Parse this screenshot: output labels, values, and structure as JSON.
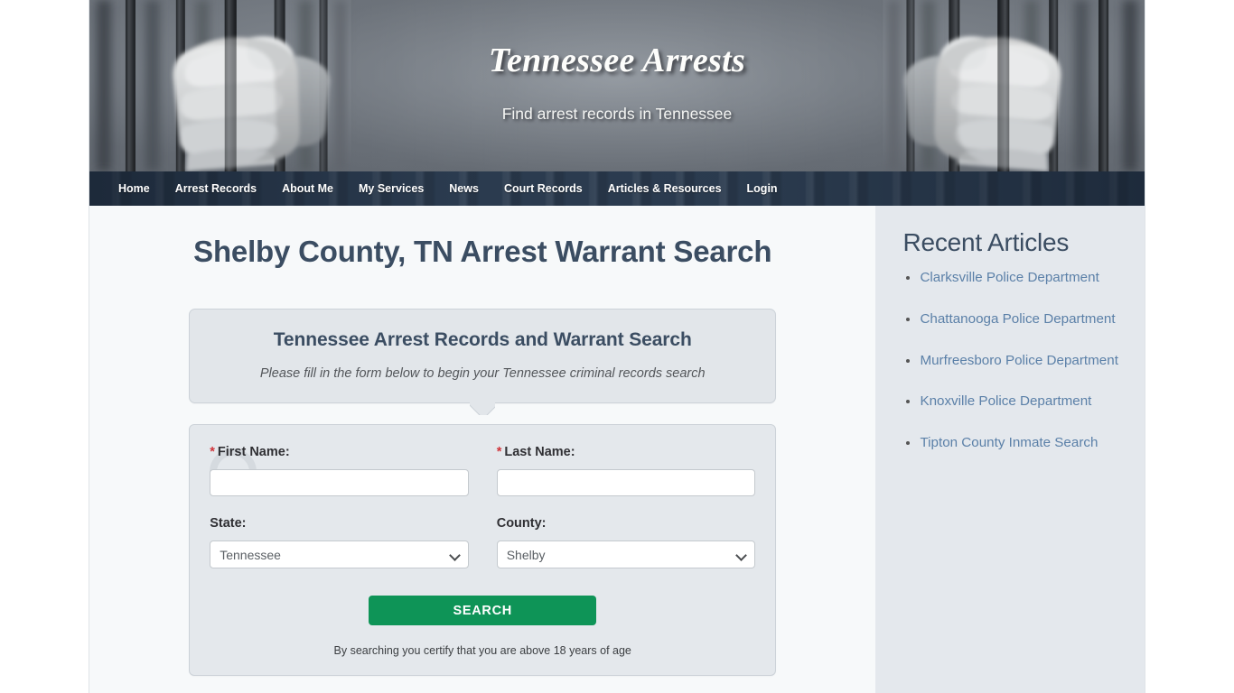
{
  "site": {
    "title": "Tennessee Arrests",
    "tagline": "Find arrest records in Tennessee"
  },
  "nav": {
    "items": [
      {
        "label": "Home"
      },
      {
        "label": "Arrest Records"
      },
      {
        "label": "About Me"
      },
      {
        "label": "My Services"
      },
      {
        "label": "News"
      },
      {
        "label": "Court Records"
      },
      {
        "label": "Articles & Resources"
      },
      {
        "label": "Login"
      }
    ]
  },
  "main": {
    "page_title": "Shelby County, TN Arrest Warrant Search",
    "bubble": {
      "heading": "Tennessee Arrest Records and Warrant Search",
      "subtext": "Please fill in the form below to begin your Tennessee criminal records search"
    },
    "form": {
      "first_name": {
        "required_marker": "*",
        "label": "First Name:",
        "value": "",
        "placeholder": ""
      },
      "last_name": {
        "required_marker": "*",
        "label": "Last Name:",
        "value": "",
        "placeholder": ""
      },
      "state": {
        "label": "State:",
        "value": "Tennessee",
        "options": [
          "Tennessee"
        ]
      },
      "county": {
        "label": "County:",
        "value": "Shelby",
        "options": [
          "Shelby"
        ]
      },
      "submit_label": "SEARCH",
      "disclaimer": "By searching you certify that you are above 18 years of age"
    }
  },
  "sidebar": {
    "heading": "Recent Articles",
    "articles": [
      {
        "label": "Clarksville Police Department"
      },
      {
        "label": "Chattanooga Police Department"
      },
      {
        "label": "Murfreesboro Police Department"
      },
      {
        "label": "Knoxville Police Department"
      },
      {
        "label": "Tipton County Inmate Search"
      }
    ]
  },
  "colors": {
    "nav_bg": "#2a3a4d",
    "heading": "#3b4d62",
    "link": "#5b80a8",
    "button": "#0e9457",
    "required": "#d0343a",
    "sidebar_bg": "#e4e8ed",
    "panel_bg": "#e4e8ec"
  }
}
